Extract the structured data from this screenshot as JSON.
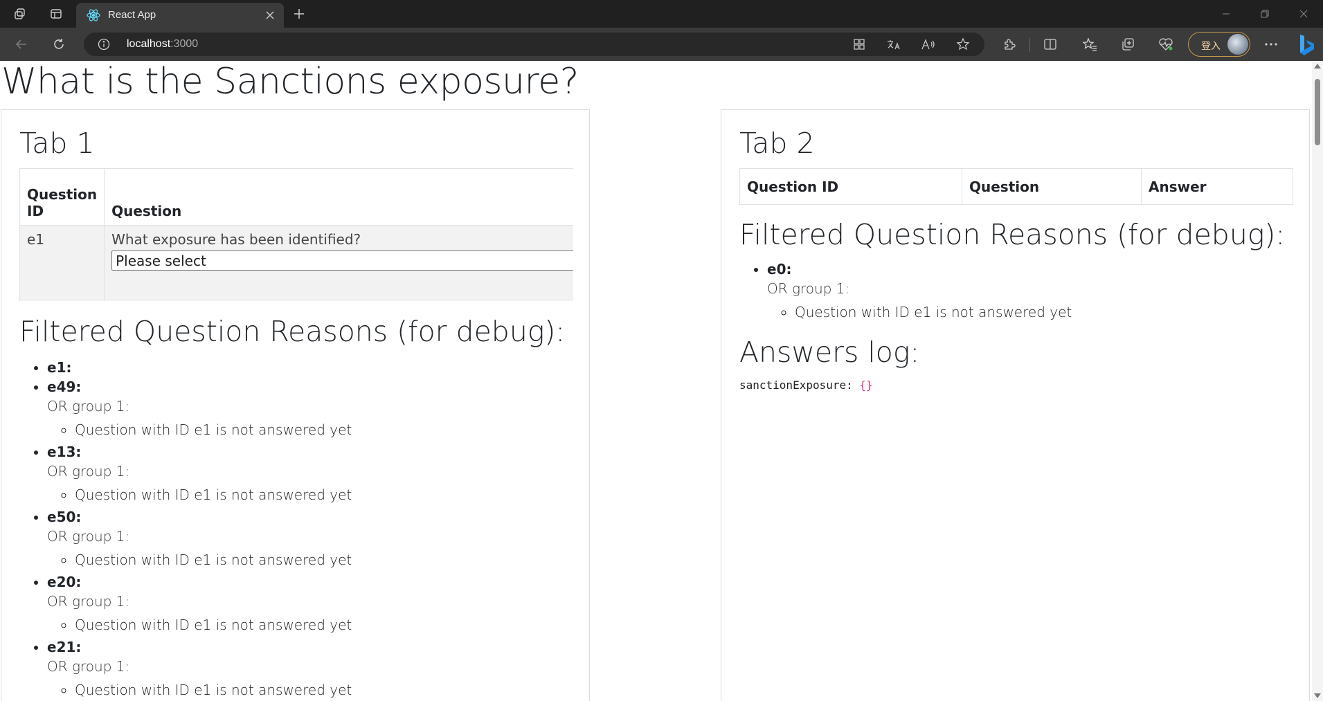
{
  "browser": {
    "tab_title": "React App",
    "url_host": "localhost",
    "url_port": ":3000",
    "signin_label": "登入"
  },
  "page": {
    "title": "What is the Sanctions exposure?"
  },
  "tab1": {
    "title": "Tab 1",
    "table": {
      "header_id": "Question ID",
      "header_question": "Question",
      "rows": [
        {
          "id": "e1",
          "question": "What exposure has been identified?",
          "select_value": "Please select"
        }
      ]
    },
    "reasons_title": "Filtered Question Reasons (for debug):",
    "reasons": [
      {
        "id": "e1:"
      },
      {
        "id": "e49:",
        "group": "OR group 1:",
        "reason": "Question with ID e1 is not answered yet"
      },
      {
        "id": "e13:",
        "group": "OR group 1:",
        "reason": "Question with ID e1 is not answered yet"
      },
      {
        "id": "e50:",
        "group": "OR group 1:",
        "reason": "Question with ID e1 is not answered yet"
      },
      {
        "id": "e20:",
        "group": "OR group 1:",
        "reason": "Question with ID e1 is not answered yet"
      },
      {
        "id": "e21:",
        "group": "OR group 1:",
        "reason": "Question with ID e1 is not answered yet"
      }
    ]
  },
  "tab2": {
    "title": "Tab 2",
    "table": {
      "header_id": "Question ID",
      "header_question": "Question",
      "header_answer": "Answer"
    },
    "reasons_title": "Filtered Question Reasons (for debug):",
    "reasons": [
      {
        "id": "e0:",
        "group": "OR group 1:",
        "reason": "Question with ID e1 is not answered yet"
      }
    ],
    "answers_title": "Answers log:",
    "log_key": "sanctionExposure:",
    "log_value": "{}"
  }
}
